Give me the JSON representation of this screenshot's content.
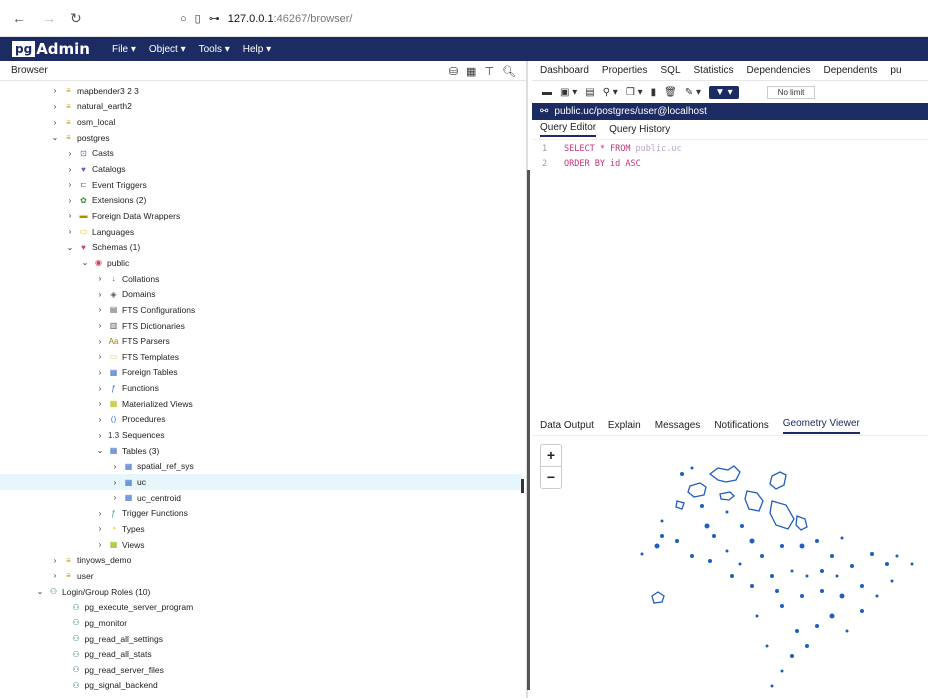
{
  "browser": {
    "host": "127.0.0.1",
    "path": ":46267/browser/"
  },
  "menubar": {
    "logo_pg": "pg",
    "logo_admin": "Admin",
    "menus": [
      "File ▾",
      "Object ▾",
      "Tools ▾",
      "Help ▾"
    ]
  },
  "left": {
    "title": "Browser"
  },
  "tree": [
    {
      "label": "mapbender3 2 3",
      "level": 0,
      "chev": "›",
      "icon": "database-icon"
    },
    {
      "label": "natural_earth2",
      "level": 0,
      "chev": "›",
      "icon": "database-icon"
    },
    {
      "label": "osm_local",
      "level": 0,
      "chev": "›",
      "icon": "database-icon"
    },
    {
      "label": "postgres",
      "level": 0,
      "chev": "⌄",
      "icon": "database-icon"
    },
    {
      "label": "Casts",
      "level": 1,
      "chev": "›",
      "icon": "casts-icon"
    },
    {
      "label": "Catalogs",
      "level": 1,
      "chev": "›",
      "icon": "catalogs-icon"
    },
    {
      "label": "Event Triggers",
      "level": 1,
      "chev": "›",
      "icon": "event-trigger-icon"
    },
    {
      "label": "Extensions (2)",
      "level": 1,
      "chev": "›",
      "icon": "extension-icon"
    },
    {
      "label": "Foreign Data Wrappers",
      "level": 1,
      "chev": "›",
      "icon": "fdw-icon"
    },
    {
      "label": "Languages",
      "level": 1,
      "chev": "›",
      "icon": "language-icon"
    },
    {
      "label": "Schemas (1)",
      "level": 1,
      "chev": "⌄",
      "icon": "schema-icon"
    },
    {
      "label": "public",
      "level": 2,
      "chev": "⌄",
      "icon": "schema-public-icon"
    },
    {
      "label": "Collations",
      "level": 3,
      "chev": "›",
      "icon": "collation-icon"
    },
    {
      "label": "Domains",
      "level": 3,
      "chev": "›",
      "icon": "domain-icon"
    },
    {
      "label": "FTS Configurations",
      "level": 3,
      "chev": "›",
      "icon": "fts-config-icon"
    },
    {
      "label": "FTS Dictionaries",
      "level": 3,
      "chev": "›",
      "icon": "fts-dict-icon"
    },
    {
      "label": "FTS Parsers",
      "level": 3,
      "chev": "›",
      "icon": "fts-parser-icon"
    },
    {
      "label": "FTS Templates",
      "level": 3,
      "chev": "›",
      "icon": "fts-template-icon"
    },
    {
      "label": "Foreign Tables",
      "level": 3,
      "chev": "›",
      "icon": "foreign-table-icon"
    },
    {
      "label": "Functions",
      "level": 3,
      "chev": "›",
      "icon": "function-icon"
    },
    {
      "label": "Materialized Views",
      "level": 3,
      "chev": "›",
      "icon": "matview-icon"
    },
    {
      "label": "Procedures",
      "level": 3,
      "chev": "›",
      "icon": "procedure-icon"
    },
    {
      "label": "Sequences",
      "level": 3,
      "chev": "›",
      "icon": "sequence-icon"
    },
    {
      "label": "Tables (3)",
      "level": 3,
      "chev": "⌄",
      "icon": "tables-icon"
    },
    {
      "label": "spatial_ref_sys",
      "level": 4,
      "chev": "›",
      "icon": "table-icon"
    },
    {
      "label": "uc",
      "level": 4,
      "chev": "›",
      "icon": "table-icon",
      "selected": true
    },
    {
      "label": "uc_centroid",
      "level": 4,
      "chev": "›",
      "icon": "table-icon"
    },
    {
      "label": "Trigger Functions",
      "level": 3,
      "chev": "›",
      "icon": "trigger-function-icon"
    },
    {
      "label": "Types",
      "level": 3,
      "chev": "›",
      "icon": "type-icon"
    },
    {
      "label": "Views",
      "level": 3,
      "chev": "›",
      "icon": "view-icon"
    },
    {
      "label": "tinyows_demo",
      "level": 0,
      "chev": "›",
      "icon": "database-icon"
    },
    {
      "label": "user",
      "level": 0,
      "chev": "›",
      "icon": "database-icon"
    },
    {
      "label": "Login/Group Roles (10)",
      "level": -1,
      "chev": "⌄",
      "icon": "roles-icon"
    },
    {
      "label": "pg_execute_server_program",
      "level": 0.5,
      "chev": "",
      "icon": "role-icon"
    },
    {
      "label": "pg_monitor",
      "level": 0.5,
      "chev": "",
      "icon": "role-icon"
    },
    {
      "label": "pg_read_all_settings",
      "level": 0.5,
      "chev": "",
      "icon": "role-icon"
    },
    {
      "label": "pg_read_all_stats",
      "level": 0.5,
      "chev": "",
      "icon": "role-icon"
    },
    {
      "label": "pg_read_server_files",
      "level": 0.5,
      "chev": "",
      "icon": "role-icon"
    },
    {
      "label": "pg_signal_backend",
      "level": 0.5,
      "chev": "",
      "icon": "role-icon"
    }
  ],
  "right": {
    "tabs": [
      "Dashboard",
      "Properties",
      "SQL",
      "Statistics",
      "Dependencies",
      "Dependents",
      "pu"
    ],
    "nolimit": "No limit",
    "connection": "public.uc/postgres/user@localhost",
    "editor_tabs": [
      "Query Editor",
      "Query History"
    ],
    "code": [
      {
        "n": "1",
        "kw": "SELECT * FROM",
        "tx": "public.uc"
      },
      {
        "n": "2",
        "kw": "ORDER BY id ASC",
        "tx": ""
      }
    ],
    "result_tabs": [
      "Data Output",
      "Explain",
      "Messages",
      "Notifications",
      "Geometry Viewer"
    ],
    "zoom_in": "+",
    "zoom_out": "−"
  },
  "colors": {
    "brand": "#1d2b63",
    "selected_row": "#e6f6fb",
    "map_features": "#1f5fbf"
  }
}
